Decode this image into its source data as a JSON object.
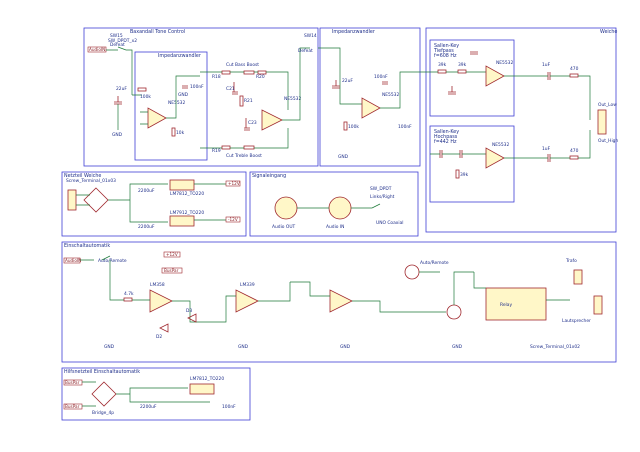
{
  "blocks": {
    "tone_control": "Baxandall Tone Control",
    "impedance_converter": "Impedanzwandler",
    "impedance_converter_2": "Impedanzwandler",
    "output": "Weiche",
    "low_pass": "Sallen-Key\nTiefpass\nf=608 Hz",
    "high_pass": "Sallen-Key\nHochpass\nf=442 Hz",
    "power_supply": "Netzteil Weiche",
    "signal_input": "Signaleingang",
    "auto_on": "Einschaltautomatik",
    "aux_supply": "Hilfsnetzteil Einschaltautomatik"
  },
  "labels": {
    "bass_boost": "Cut  Bass Boost",
    "treble_boost": "Cut Treble Boost",
    "audio_in": "AudioIN",
    "audio_in2": "AudioIN",
    "bypass": "Bypass",
    "defeat": "Defeat",
    "out_low": "Out_Low",
    "out_high": "Out_High",
    "audio_out": "Audio OUT",
    "audio_in_din": "Audio IN",
    "links_rechts": "Links/Right",
    "sw_dpdt": "SW_DPDT",
    "auto_manuell": "Auto/Manuell",
    "auto_remote": "Auto/Remote",
    "lautsprecher": "Lautsprecher",
    "trafo": "Trafo",
    "relay": "Relay",
    "screw_terminal": "Screw_Terminal_01x02",
    "uno_coaxial": "UNO Coaxial",
    "bus_par": "BusPar",
    "brp": "Bridge_4p",
    "lm7812": "LM7812_TO220",
    "lm7912": "LM7912_TO220",
    "lm7812b": "LM7812_TO220",
    "ne5532": "NE5532",
    "lm358": "LM358",
    "lm339": "LM339"
  },
  "values": {
    "r_47k": "4.7k",
    "r_10k": "10k",
    "r_100k": "100k",
    "c_100n": "100nF",
    "c_22u": "22uF",
    "c_10u": "10uF",
    "c_2200": "2200uF",
    "c_1u": "1uF",
    "gnd": "GND",
    "v12": "+12V",
    "vm12": "-12V"
  }
}
